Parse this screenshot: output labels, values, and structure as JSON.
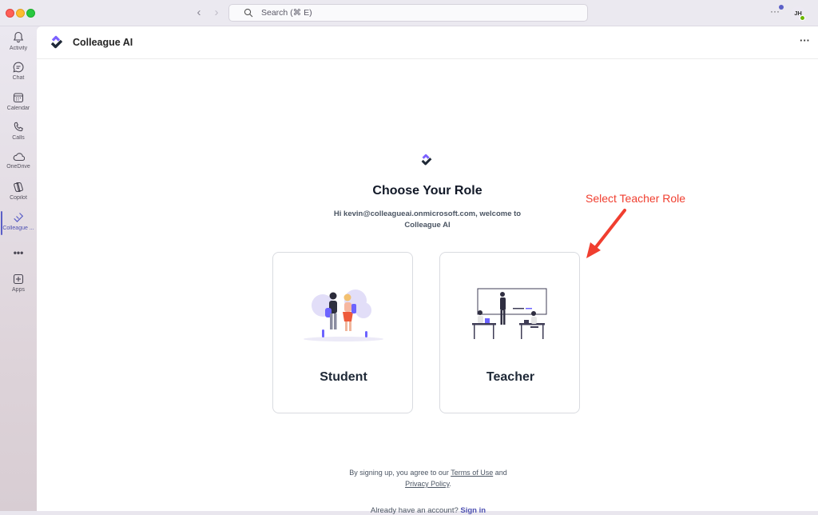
{
  "window": {
    "search_placeholder": "Search (⌘ E)",
    "more_label": "···",
    "avatar_initials": "JH"
  },
  "rail": {
    "items": [
      {
        "label": "Activity",
        "icon": "bell-icon"
      },
      {
        "label": "Chat",
        "icon": "chat-icon"
      },
      {
        "label": "Calendar",
        "icon": "calendar-icon"
      },
      {
        "label": "Calls",
        "icon": "phone-icon"
      },
      {
        "label": "OneDrive",
        "icon": "cloud-icon"
      },
      {
        "label": "Copilot",
        "icon": "copilot-icon"
      },
      {
        "label": "Colleague ...",
        "icon": "colleague-ai-icon",
        "active": true
      },
      {
        "label": "",
        "icon": "more-icon"
      },
      {
        "label": "Apps",
        "icon": "apps-plus-icon"
      }
    ],
    "more_label": "•••"
  },
  "app": {
    "title": "Colleague AI",
    "more_label": "···"
  },
  "main": {
    "heading": "Choose Your Role",
    "welcome": "Hi kevin@colleagueai.onmicrosoft.com, welcome to Colleague AI",
    "cards": [
      {
        "label": "Student"
      },
      {
        "label": "Teacher"
      }
    ],
    "terms": {
      "prefix": "By signing up, you agree to our ",
      "terms_link": "Terms of Use",
      "middle": " and",
      "privacy_link": "Privacy Policy",
      "suffix": "."
    },
    "signin_prompt": "Already have an account?",
    "signin_link": "Sign in"
  },
  "annotation": {
    "text": "Select Teacher Role",
    "color": "#f03e2f"
  },
  "colors": {
    "accent": "#5b5fc7",
    "brand_purple": "#7b61ff"
  }
}
